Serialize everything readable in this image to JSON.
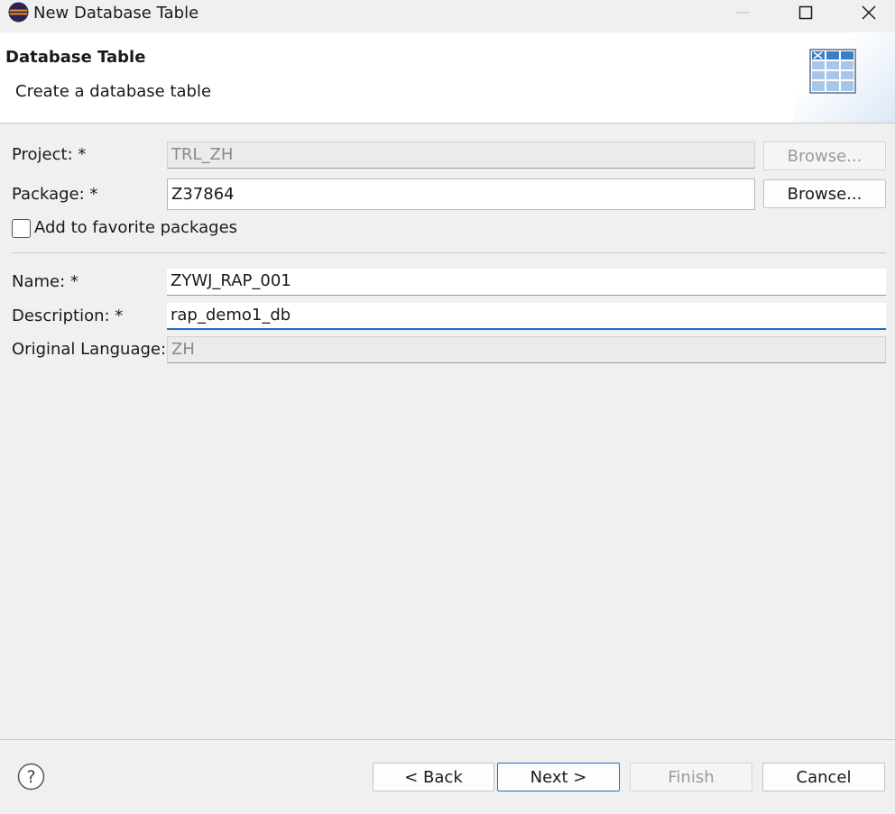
{
  "window": {
    "title": "New Database Table",
    "icon": "eclipse-icon",
    "controls": [
      "minimize-icon",
      "maximize-icon",
      "close-icon"
    ]
  },
  "header": {
    "title": "Database Table",
    "subtitle": "Create a database table",
    "icon": "table-icon"
  },
  "form": {
    "project": {
      "label": "Project: *",
      "value": "TRL_ZH",
      "browse": "Browse..."
    },
    "package": {
      "label": "Package: *",
      "value": "Z37864",
      "browse": "Browse..."
    },
    "favorite": {
      "label": "Add to favorite packages",
      "checked": false
    },
    "name": {
      "label": "Name: *",
      "value": "ZYWJ_RAP_001"
    },
    "description": {
      "label": "Description: *",
      "value": "rap_demo1_db"
    },
    "language": {
      "label": "Original Language:",
      "value": "ZH"
    }
  },
  "footer": {
    "help_icon": "help-icon",
    "back": "< Back",
    "next": "Next >",
    "finish": "Finish",
    "cancel": "Cancel"
  },
  "colors": {
    "accent": "#1a6fc7",
    "background": "#f0f0f0",
    "banner": "#ffffff"
  }
}
